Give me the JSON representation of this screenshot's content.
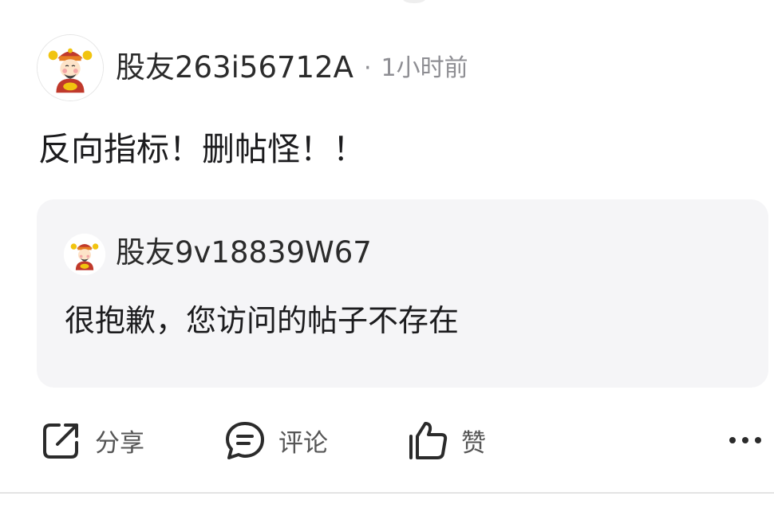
{
  "post": {
    "author": {
      "name": "股友263i56712A",
      "avatar_icon": "caishen-avatar-icon"
    },
    "time": "1小时前",
    "separator": "·",
    "content": "反向指标！删帖怪！！",
    "quoted": {
      "author": {
        "name": "股友9v18839W67",
        "avatar_icon": "caishen-avatar-icon"
      },
      "text": "很抱歉，您访问的帖子不存在"
    },
    "actions": {
      "share": {
        "label": "分享",
        "icon": "share-icon"
      },
      "comment": {
        "label": "评论",
        "icon": "comment-icon"
      },
      "like": {
        "label": "赞",
        "icon": "thumbs-up-icon"
      },
      "more": {
        "icon": "more-icon"
      }
    }
  },
  "colors": {
    "text_primary": "#1c1c1e",
    "text_secondary": "#8e8e93",
    "quote_background": "#f5f5f7",
    "icon_stroke": "#2b2b2b"
  }
}
